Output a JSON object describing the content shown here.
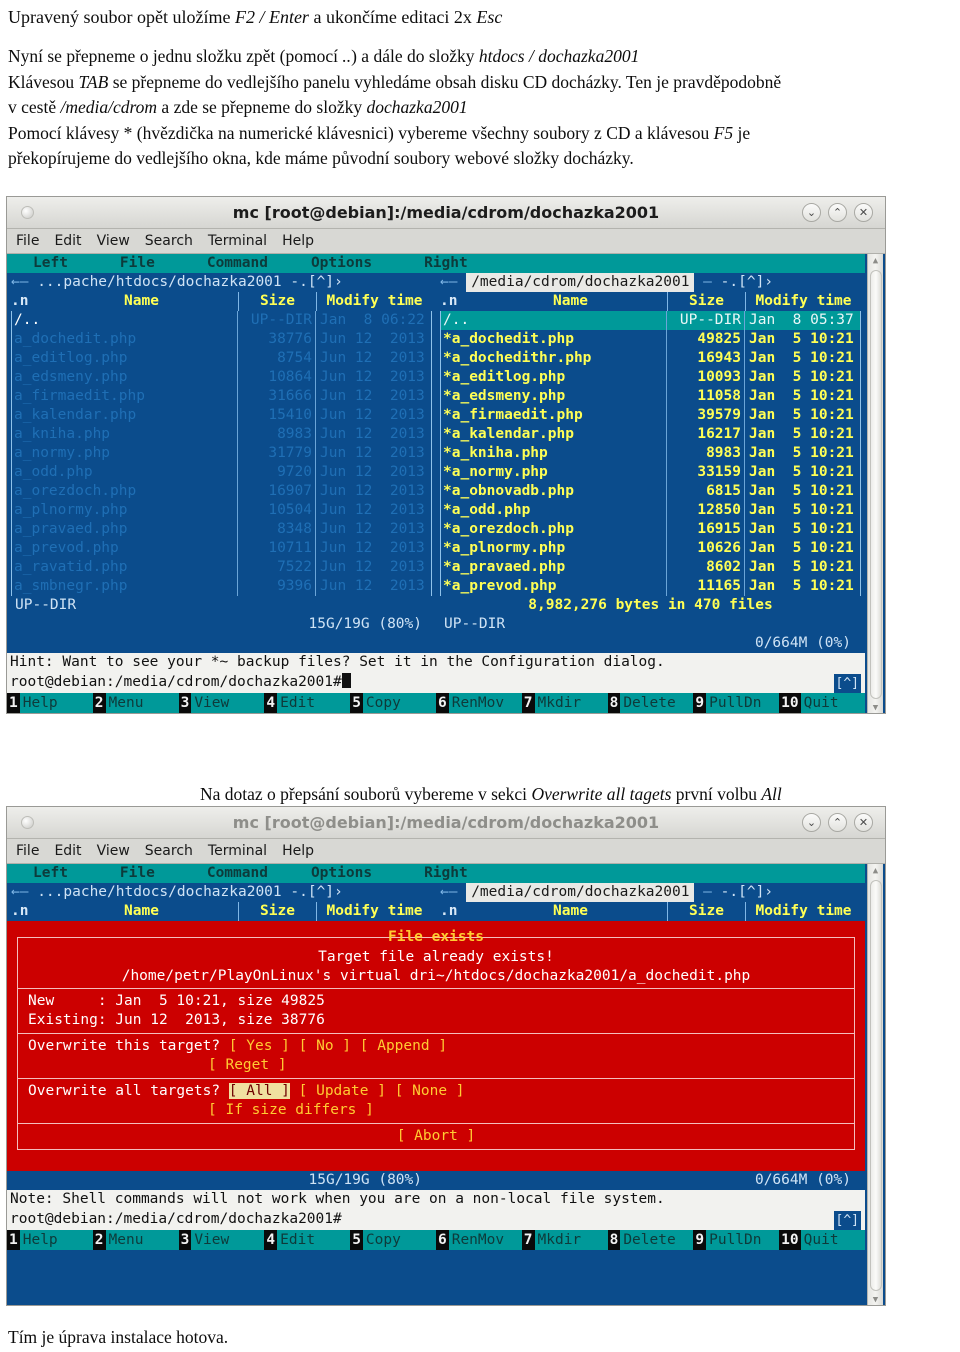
{
  "document": {
    "intro": [
      {
        "segments": [
          {
            "t": "Upravený soubor opět uložíme ",
            "i": false
          },
          {
            "t": "F2 / Enter",
            "i": true
          },
          {
            "t": " a ukončíme editaci 2x ",
            "i": false
          },
          {
            "t": "Esc",
            "i": true
          }
        ]
      }
    ],
    "paragraph2": [
      {
        "segments": [
          {
            "t": "Nyní se přepneme o jednu složku zpět (pomocí ",
            "i": false
          },
          {
            "t": "..",
            "i": true
          },
          {
            "t": ") a dále do složky ",
            "i": false
          },
          {
            "t": "htdocs / dochazka2001",
            "i": true
          }
        ]
      },
      {
        "segments": [
          {
            "t": "Klávesou ",
            "i": false
          },
          {
            "t": "TAB",
            "i": true
          },
          {
            "t": " se přepneme do vedlejšího panelu vyhledáme obsah disku CD docházky. Ten je pravděpodobně",
            "i": false
          }
        ]
      },
      {
        "segments": [
          {
            "t": "v cestě ",
            "i": false
          },
          {
            "t": "/media/cdrom",
            "i": true
          },
          {
            "t": " a zde se přepneme do složky ",
            "i": false
          },
          {
            "t": "dochazka2001",
            "i": true
          }
        ]
      },
      {
        "segments": [
          {
            "t": "Pomocí klávesy * (hvězdička na numerické klávesnici) vybereme všechny soubory z CD a klávesou ",
            "i": false
          },
          {
            "t": "F5",
            "i": true
          },
          {
            "t": " je",
            "i": false
          }
        ]
      },
      {
        "segments": [
          {
            "t": "překopírujeme do vedlejšího okna, kde máme původní soubory webové složky docházky.",
            "i": false
          }
        ]
      }
    ],
    "mid_note": [
      {
        "segments": [
          {
            "t": "Na dotaz o přepsání souborů vybereme v sekci ",
            "i": false
          },
          {
            "t": "Overwrite all tagets",
            "i": true
          },
          {
            "t": " první volbu ",
            "i": false
          },
          {
            "t": "All",
            "i": true
          }
        ]
      }
    ],
    "end_note": [
      {
        "segments": [
          {
            "t": "Tím je úprava instalace hotova.",
            "i": false
          }
        ]
      }
    ]
  },
  "window": {
    "title": "mc [root@debian]:/media/cdrom/dochazka2001",
    "buttons": [
      {
        "name": "minimize-button",
        "glyph": "⌄"
      },
      {
        "name": "maximize-button",
        "glyph": "⌃"
      },
      {
        "name": "close-button",
        "glyph": "✕"
      }
    ],
    "menubar": [
      "File",
      "Edit",
      "View",
      "Search",
      "Terminal",
      "Help"
    ]
  },
  "mc": {
    "menu": [
      "Left",
      "File",
      "Command",
      "Options",
      "Right"
    ],
    "left_panel": {
      "path_label": "...pache/htdocs/dochazka2001",
      "path_decor_left": "←",
      "path_decor_right": "-.[^]›",
      "columns": [
        "n",
        "Name",
        "Size",
        "Modify time"
      ],
      "col_mark": ".n",
      "updir": {
        "name": "/..",
        "size": "UP--DIR",
        "time": "Jan  8 06:22"
      },
      "files": [
        {
          "name": "a_dochedit.php",
          "size": "38776",
          "time": "Jun 12  2013"
        },
        {
          "name": "a_editlog.php",
          "size": "8754",
          "time": "Jun 12  2013"
        },
        {
          "name": "a_edsmeny.php",
          "size": "10864",
          "time": "Jun 12  2013"
        },
        {
          "name": "a_firmaedit.php",
          "size": "31666",
          "time": "Jun 12  2013"
        },
        {
          "name": "a_kalendar.php",
          "size": "15410",
          "time": "Jun 12  2013"
        },
        {
          "name": "a_kniha.php",
          "size": "8983",
          "time": "Jun 12  2013"
        },
        {
          "name": "a_normy.php",
          "size": "31779",
          "time": "Jun 12  2013"
        },
        {
          "name": "a_odd.php",
          "size": "9720",
          "time": "Jun 12  2013"
        },
        {
          "name": "a_orezdoch.php",
          "size": "16907",
          "time": "Jun 12  2013"
        },
        {
          "name": "a_plnormy.php",
          "size": "10504",
          "time": "Jun 12  2013"
        },
        {
          "name": "a_pravaed.php",
          "size": "8348",
          "time": "Jun 12  2013"
        },
        {
          "name": "a_prevod.php",
          "size": "10711",
          "time": "Jun 12  2013"
        },
        {
          "name": "a_ravatid.php",
          "size": "7522",
          "time": "Jun 12  2013"
        },
        {
          "name": "a_smbnegr.php",
          "size": "9396",
          "time": "Jun 12  2013"
        }
      ],
      "mini_status": "UP--DIR",
      "free_space": "15G/19G (80%)"
    },
    "right_panel": {
      "path_label": "/media/cdrom/dochazka2001",
      "path_decor_left": "←",
      "path_decor_right": "-.[^]›",
      "columns": [
        "n",
        "Name",
        "Size",
        "Modify time"
      ],
      "col_mark": ".n",
      "updir": {
        "name": "/..",
        "size": "UP--DIR",
        "time": "Jan  8 05:37"
      },
      "files": [
        {
          "name": "a_dochedit.php",
          "size": "49825",
          "time": "Jan  5 10:21"
        },
        {
          "name": "a_dochedithr.php",
          "size": "16943",
          "time": "Jan  5 10:21"
        },
        {
          "name": "a_editlog.php",
          "size": "10093",
          "time": "Jan  5 10:21"
        },
        {
          "name": "a_edsmeny.php",
          "size": "11058",
          "time": "Jan  5 10:21"
        },
        {
          "name": "a_firmaedit.php",
          "size": "39579",
          "time": "Jan  5 10:21"
        },
        {
          "name": "a_kalendar.php",
          "size": "16217",
          "time": "Jan  5 10:21"
        },
        {
          "name": "a_kniha.php",
          "size": "8983",
          "time": "Jan  5 10:21"
        },
        {
          "name": "a_normy.php",
          "size": "33159",
          "time": "Jan  5 10:21"
        },
        {
          "name": "a_obnovadb.php",
          "size": "6815",
          "time": "Jan  5 10:21"
        },
        {
          "name": "a_odd.php",
          "size": "12850",
          "time": "Jan  5 10:21"
        },
        {
          "name": "a_orezdoch.php",
          "size": "16915",
          "time": "Jan  5 10:21"
        },
        {
          "name": "a_plnormy.php",
          "size": "10626",
          "time": "Jan  5 10:21"
        },
        {
          "name": "a_pravaed.php",
          "size": "8602",
          "time": "Jan  5 10:21"
        },
        {
          "name": "a_prevod.php",
          "size": "11165",
          "time": "Jan  5 10:21"
        }
      ],
      "total_line": "8,982,276 bytes in 470 files",
      "mini_status": "UP--DIR",
      "free_space": "0/664M (0%)"
    },
    "hint_1": "Hint: Want to see your *~ backup files? Set it in the Configuration dialog.",
    "hint_2": "Note: Shell commands will not work when you are on a non-local file system.",
    "prompt": "root@debian:/media/cdrom/dochazka2001#",
    "caret_button": "[^]",
    "fkeys": [
      {
        "num": "1",
        "label": "Help"
      },
      {
        "num": "2",
        "label": "Menu"
      },
      {
        "num": "3",
        "label": "View"
      },
      {
        "num": "4",
        "label": "Edit"
      },
      {
        "num": "5",
        "label": "Copy"
      },
      {
        "num": "6",
        "label": "RenMov"
      },
      {
        "num": "7",
        "label": "Mkdir"
      },
      {
        "num": "8",
        "label": "Delete"
      },
      {
        "num": "9",
        "label": "PullDn"
      },
      {
        "num": "10",
        "label": "Quit"
      }
    ]
  },
  "dialog": {
    "title": "File exists",
    "message": "Target file already exists!",
    "target_path": "/home/petr/PlayOnLinux's virtual dri~/htdocs/dochazka2001/a_dochedit.php",
    "new_line": "New     : Jan  5 10:21, size 49825",
    "existing_line": "Existing: Jun 12  2013, size 38776",
    "q1_label": "Overwrite this target?",
    "q1_buttons": [
      "[ Yes ]",
      "[ No ]",
      "[ Append ]"
    ],
    "q1_buttons_row2": [
      "[ Reget ]"
    ],
    "q2_label": "Overwrite all targets?",
    "q2_buttons": [
      "[ All ]",
      "[ Update ]",
      "[ None ]"
    ],
    "q2_buttons_row2": [
      "[ If size differs ]"
    ],
    "q2_selected": "[ All ]",
    "abort_button": "[ Abort ]"
  },
  "colors": {
    "mc_bg": "#0b4c8c",
    "mc_menu": "#009999",
    "mc_yellow": "#ffff55",
    "dialog_red": "#cc0000",
    "dialog_title": "#ffcc33",
    "selected_bg": "#f0e0a0"
  }
}
